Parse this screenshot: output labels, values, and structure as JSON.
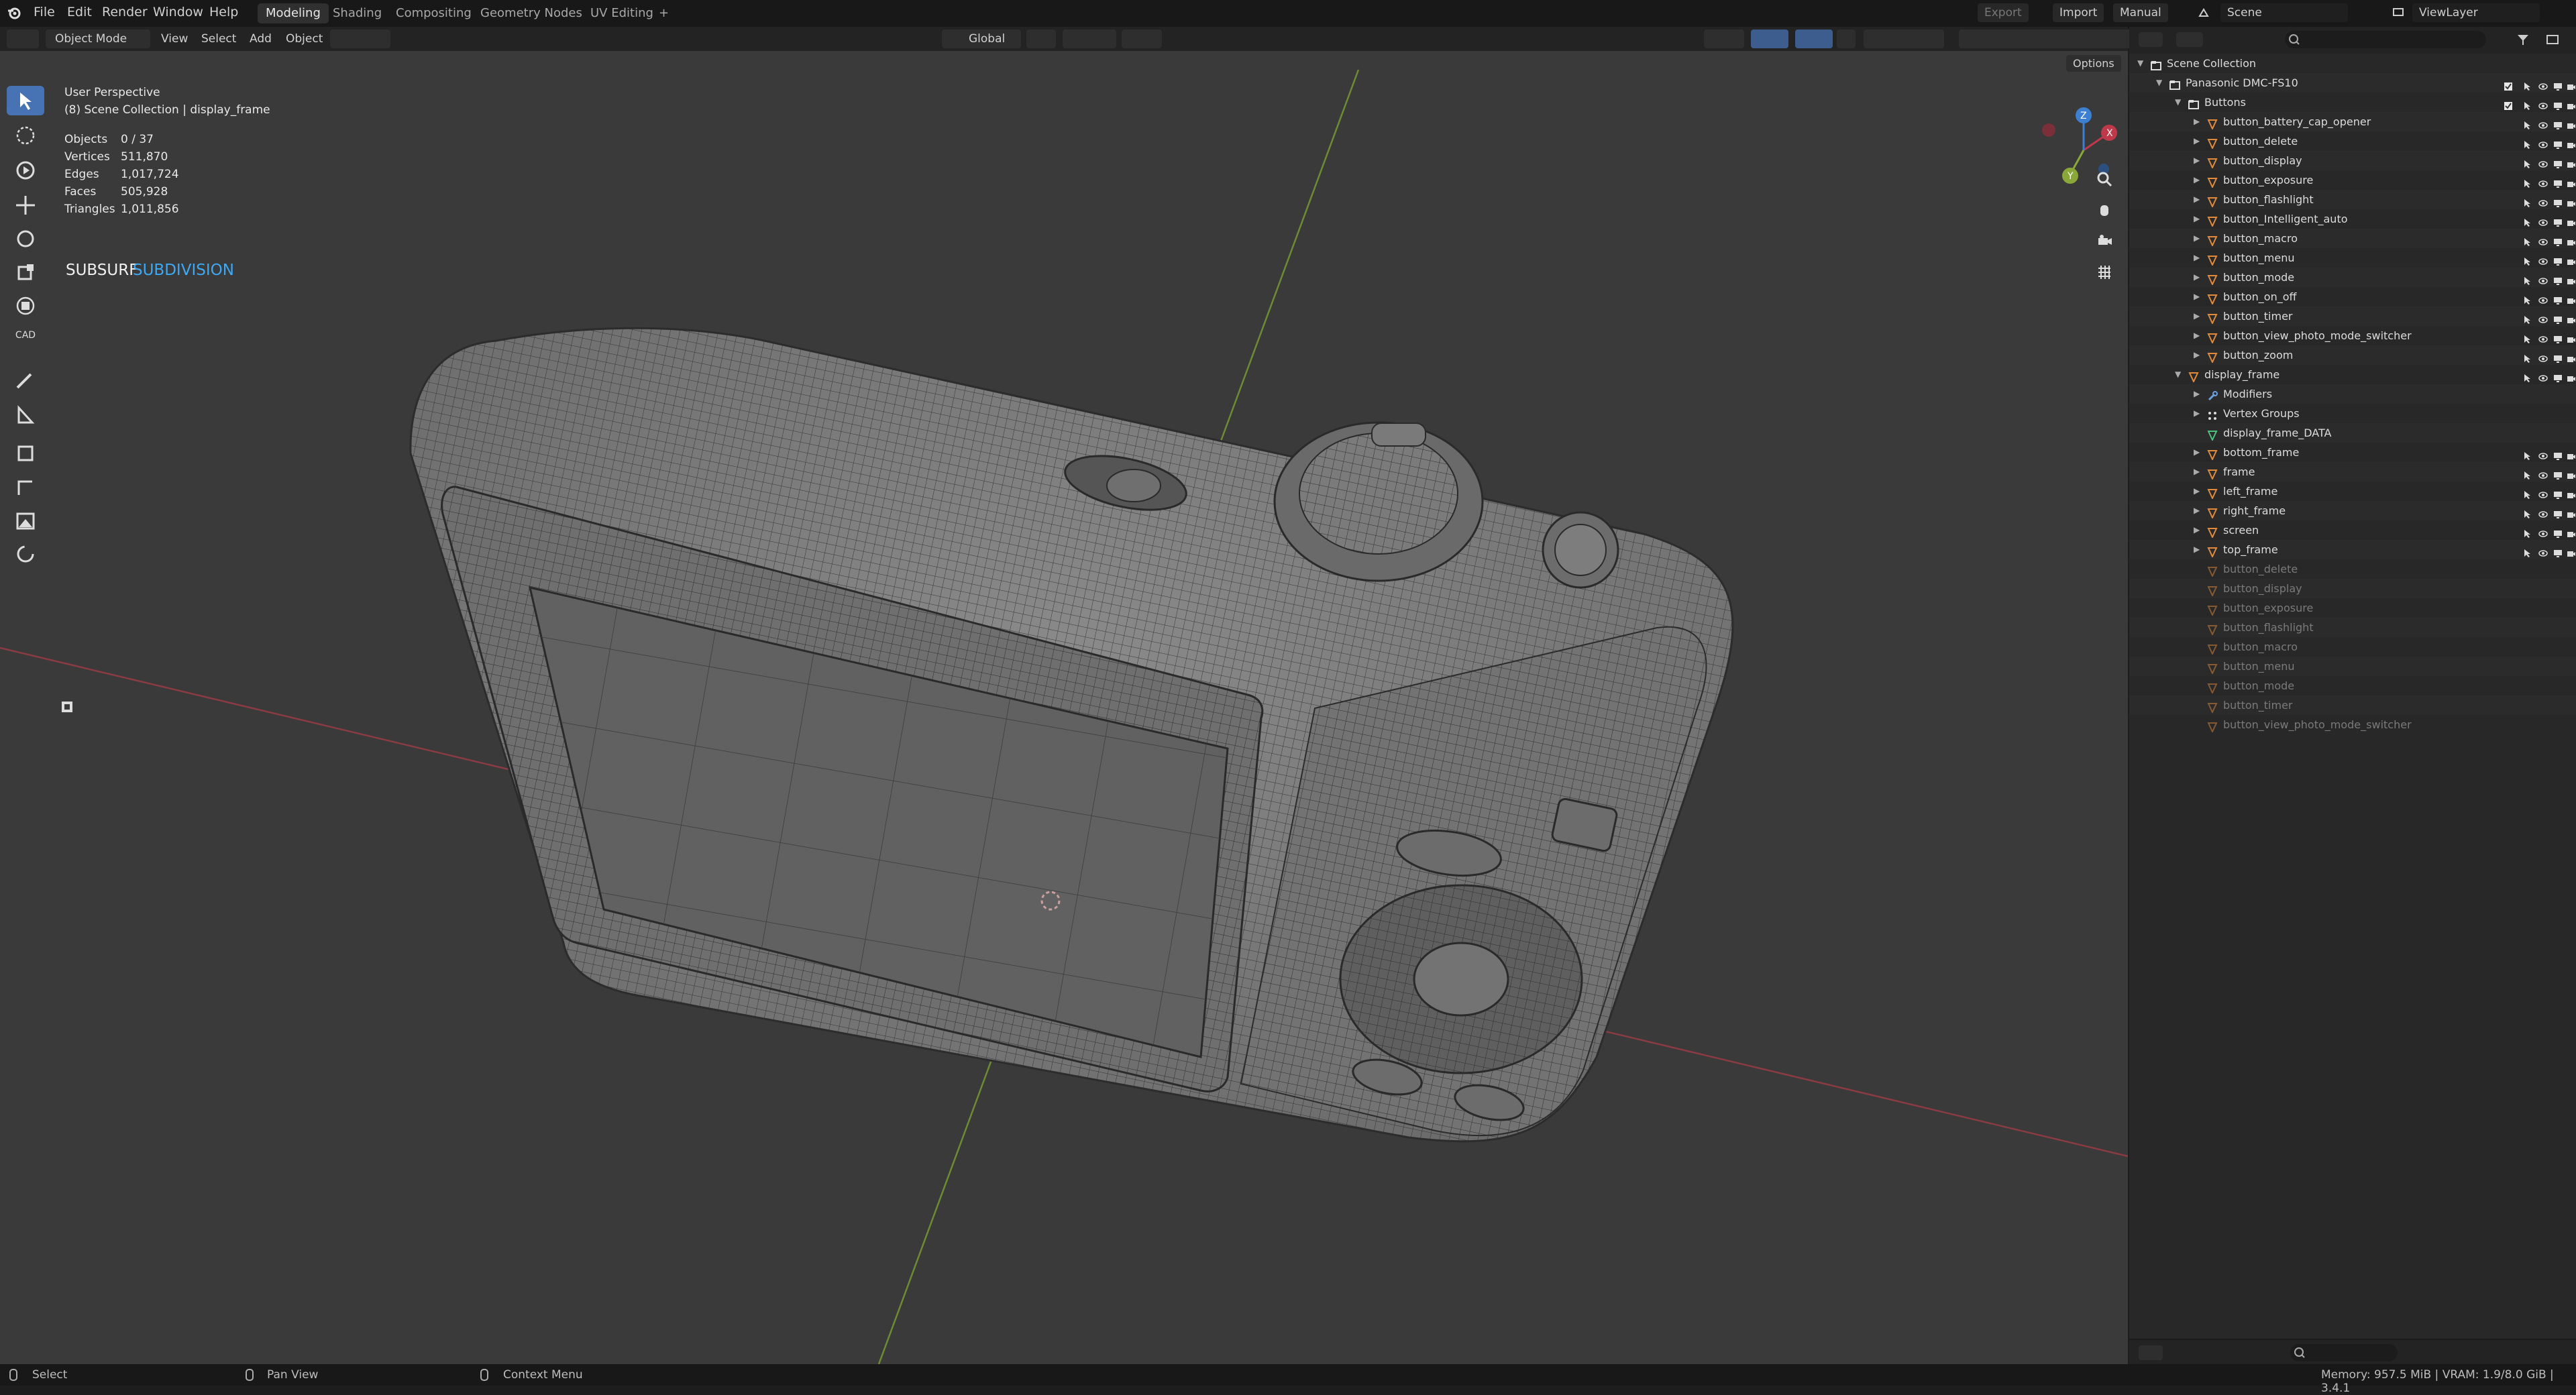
{
  "menu": {
    "items": [
      "File",
      "Edit",
      "Render",
      "Window",
      "Help"
    ],
    "workspaces": [
      "Modeling",
      "Shading",
      "Compositing",
      "Geometry Nodes",
      "UV Editing"
    ],
    "add_workspace": "+",
    "export_label": "Export",
    "import_label": "Import",
    "manual_label": "Manual",
    "scene_label": "Scene",
    "viewlayer_label": "ViewLayer"
  },
  "header": {
    "mode": "Object Mode",
    "menus": [
      "View",
      "Select",
      "Add",
      "Object"
    ],
    "orientation": "Global",
    "options_label": "Options"
  },
  "viewport": {
    "perspective": "User Perspective",
    "collection": "(8) Scene Collection | display_frame",
    "stats": [
      {
        "label": "Objects",
        "value": "0 / 37"
      },
      {
        "label": "Vertices",
        "value": "511,870"
      },
      {
        "label": "Edges",
        "value": "1,017,724"
      },
      {
        "label": "Faces",
        "value": "505,928"
      },
      {
        "label": "Triangles",
        "value": "1,011,856"
      }
    ],
    "overlay_white": "SUBSURF",
    "overlay_blue": "SUBDIVISION",
    "cad_label": "CAD",
    "gizmo": {
      "x": "X",
      "y": "Y",
      "z": "Z"
    }
  },
  "outliner": {
    "rows": [
      {
        "name": "Scene Collection",
        "level": 0,
        "icon": "collection",
        "grey": false
      },
      {
        "name": "Panasonic DMC-FS10",
        "level": 1,
        "icon": "collection",
        "grey": false
      },
      {
        "name": "Buttons",
        "level": 2,
        "icon": "collection",
        "grey": false
      },
      {
        "name": "button_battery_cap_opener",
        "level": 3,
        "icon": "mesh",
        "grey": false
      },
      {
        "name": "button_delete",
        "level": 3,
        "icon": "mesh",
        "grey": false
      },
      {
        "name": "button_display",
        "level": 3,
        "icon": "mesh",
        "grey": false
      },
      {
        "name": "button_exposure",
        "level": 3,
        "icon": "mesh",
        "grey": false
      },
      {
        "name": "button_flashlight",
        "level": 3,
        "icon": "mesh",
        "grey": false
      },
      {
        "name": "button_Intelligent_auto",
        "level": 3,
        "icon": "mesh",
        "grey": false
      },
      {
        "name": "button_macro",
        "level": 3,
        "icon": "mesh",
        "grey": false
      },
      {
        "name": "button_menu",
        "level": 3,
        "icon": "mesh",
        "grey": false
      },
      {
        "name": "button_mode",
        "level": 3,
        "icon": "mesh",
        "grey": false
      },
      {
        "name": "button_on_off",
        "level": 3,
        "icon": "mesh",
        "grey": false
      },
      {
        "name": "button_timer",
        "level": 3,
        "icon": "mesh",
        "grey": false
      },
      {
        "name": "button_view_photo_mode_switcher",
        "level": 3,
        "icon": "mesh",
        "grey": false
      },
      {
        "name": "button_zoom",
        "level": 3,
        "icon": "mesh",
        "grey": false
      },
      {
        "name": "display_frame",
        "level": 2,
        "icon": "mesh",
        "grey": false
      },
      {
        "name": "Modifiers",
        "level": 3,
        "icon": "wrench",
        "grey": false
      },
      {
        "name": "Vertex Groups",
        "level": 3,
        "icon": "vgroup",
        "grey": false
      },
      {
        "name": "display_frame_DATA",
        "level": 3,
        "icon": "meshdata",
        "grey": false
      },
      {
        "name": "bottom_frame",
        "level": 3,
        "icon": "mesh",
        "grey": false
      },
      {
        "name": "frame",
        "level": 3,
        "icon": "mesh",
        "grey": false
      },
      {
        "name": "left_frame",
        "level": 3,
        "icon": "mesh",
        "grey": false
      },
      {
        "name": "right_frame",
        "level": 3,
        "icon": "mesh",
        "grey": false
      },
      {
        "name": "screen",
        "level": 3,
        "icon": "mesh",
        "grey": false
      },
      {
        "name": "top_frame",
        "level": 3,
        "icon": "mesh",
        "grey": false
      },
      {
        "name": "button_delete",
        "level": 3,
        "icon": "mesh",
        "grey": true
      },
      {
        "name": "button_display",
        "level": 3,
        "icon": "mesh",
        "grey": true
      },
      {
        "name": "button_exposure",
        "level": 3,
        "icon": "mesh",
        "grey": true
      },
      {
        "name": "button_flashlight",
        "level": 3,
        "icon": "mesh",
        "grey": true
      },
      {
        "name": "button_macro",
        "level": 3,
        "icon": "mesh",
        "grey": true
      },
      {
        "name": "button_menu",
        "level": 3,
        "icon": "mesh",
        "grey": true
      },
      {
        "name": "button_mode",
        "level": 3,
        "icon": "mesh",
        "grey": true
      },
      {
        "name": "button_timer",
        "level": 3,
        "icon": "mesh",
        "grey": true
      },
      {
        "name": "button_view_photo_mode_switcher",
        "level": 3,
        "icon": "mesh",
        "grey": true
      }
    ]
  },
  "statusbar": {
    "select": "Select",
    "pan": "Pan View",
    "context": "Context Menu",
    "memory": "Memory: 957.5 MiB | VRAM: 1.9/8.0 GiB | 3.4.1"
  },
  "colors": {
    "accent": "#4772b3",
    "subdivision_blue": "#3da9f5",
    "axis_red": "#c0394b",
    "axis_green": "#8aa83a",
    "mesh_orange": "#e08a3c"
  }
}
